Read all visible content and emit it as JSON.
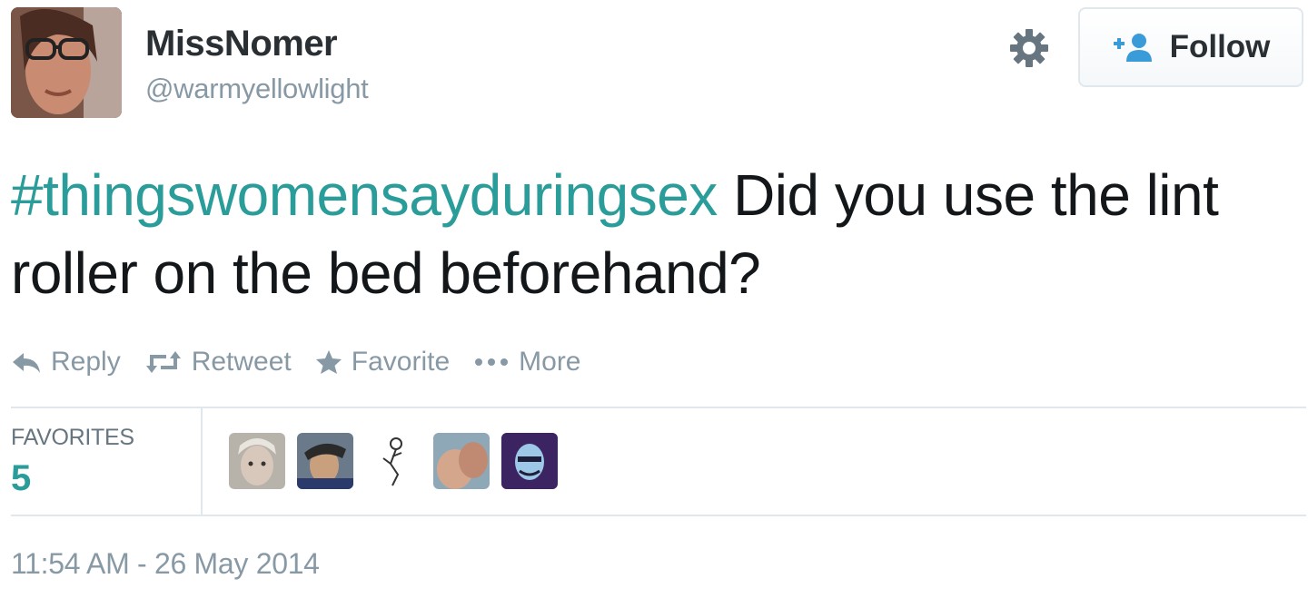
{
  "user": {
    "display_name": "MissNomer",
    "screen_name": "@warmyellowlight"
  },
  "header": {
    "follow_label": "Follow",
    "gear_icon": "gear-icon",
    "follow_icon": "add-user-icon"
  },
  "tweet": {
    "hashtag": "#thingswomensayduringsex",
    "text": " Did you use the lint roller on the bed beforehand?"
  },
  "actions": [
    {
      "label": "Reply",
      "icon": "reply-icon"
    },
    {
      "label": "Retweet",
      "icon": "retweet-icon"
    },
    {
      "label": "Favorite",
      "icon": "star-icon"
    },
    {
      "label": "More",
      "icon": "more-dots-icon"
    }
  ],
  "stats": {
    "favorites_label": "FAVORITES",
    "favorites_count": "5",
    "favoriter_avatar_count": 5
  },
  "timestamp": "11:54 AM - 26 May 2014",
  "colors": {
    "hashtag": "#2a9d9a",
    "secondary_text": "#8899a6",
    "follow_icon": "#3a9bd9",
    "divider": "#e1e8ed"
  }
}
